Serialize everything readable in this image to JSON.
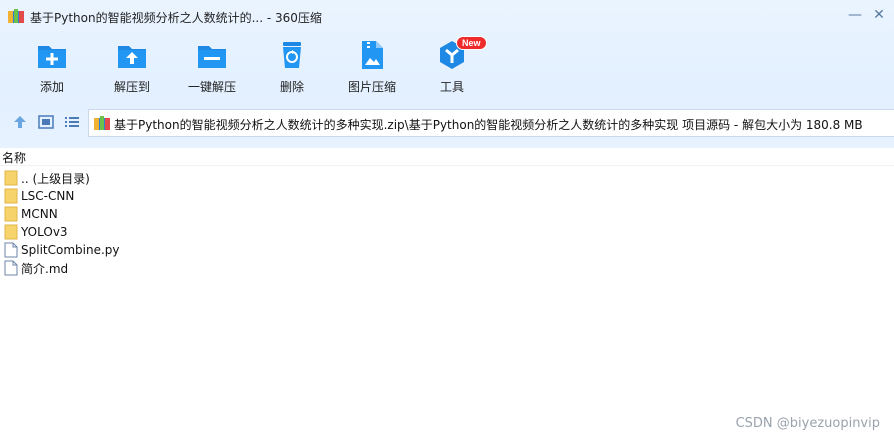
{
  "window": {
    "title": "基于Python的智能视频分析之人数统计的... - 360压缩"
  },
  "toolbar": {
    "items": [
      {
        "label": "添加",
        "icon": "add-folder-icon"
      },
      {
        "label": "解压到",
        "icon": "extract-to-icon"
      },
      {
        "label": "一键解压",
        "icon": "one-click-extract-icon"
      },
      {
        "label": "删除",
        "icon": "recycle-bin-icon"
      },
      {
        "label": "图片压缩",
        "icon": "image-compress-icon"
      },
      {
        "label": "工具",
        "icon": "tools-icon",
        "badge": "New"
      }
    ]
  },
  "address": {
    "path": "基于Python的智能视频分析之人数统计的多种实现.zip\\基于Python的智能视频分析之人数统计的多种实现 项目源码 - 解包大小为 180.8 MB"
  },
  "list": {
    "column_name": "名称",
    "rows": [
      {
        "name": ".. (上级目录)",
        "type": "folder"
      },
      {
        "name": "LSC-CNN",
        "type": "folder"
      },
      {
        "name": "MCNN",
        "type": "folder"
      },
      {
        "name": "YOLOv3",
        "type": "folder"
      },
      {
        "name": "SplitCombine.py",
        "type": "file"
      },
      {
        "name": "简介.md",
        "type": "file"
      }
    ]
  },
  "watermark": "CSDN @biyezuopinvip",
  "colors": {
    "accent_blue": "#1e88e5",
    "header_bg": "#e6f1ff",
    "badge_red": "#ee2c2c",
    "folder_yellow": "#f6d36b"
  }
}
